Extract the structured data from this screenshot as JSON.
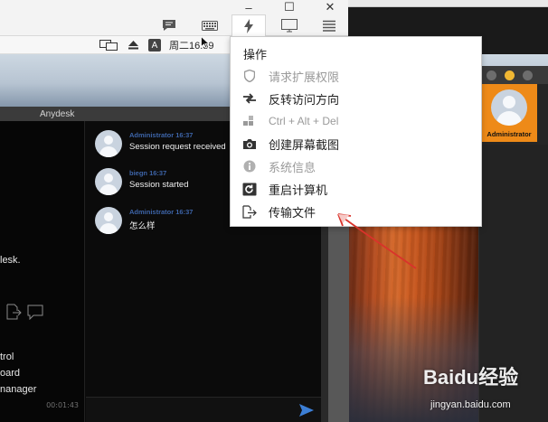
{
  "toolbar": {
    "controls": [
      "–",
      "☐",
      "✕"
    ],
    "tools": [
      "chat-icon",
      "keyboard-icon",
      "actions-icon",
      "display-icon",
      "menu-icon"
    ]
  },
  "menubar": {
    "ime_badge": "A",
    "clock": "周二16:39"
  },
  "anydesk": {
    "title": "Anydesk",
    "left_texts": [
      "lesk.",
      "trol",
      "oard",
      "nanager"
    ],
    "elapsed": "00:01:43",
    "messages": [
      {
        "name": "Administrator 16:37",
        "text": "Session request received"
      },
      {
        "name": "biegn 16:37",
        "text": "Session started"
      },
      {
        "name": "Administrator 16:37",
        "text": "怎么样"
      }
    ]
  },
  "menu": {
    "header": "操作",
    "items": [
      {
        "label": "请求扩展权限",
        "icon": "shield-icon",
        "enabled": false
      },
      {
        "label": "反转访问方向",
        "icon": "switch-direction-icon",
        "enabled": true
      },
      {
        "label": "Ctrl + Alt + Del",
        "icon": "ctrl-alt-del-icon",
        "enabled": false
      },
      {
        "label": "创建屏幕截图",
        "icon": "camera-icon",
        "enabled": true
      },
      {
        "label": "系统信息",
        "icon": "info-icon",
        "enabled": false
      },
      {
        "label": "重启计算机",
        "icon": "restart-icon",
        "enabled": true
      },
      {
        "label": "传输文件",
        "icon": "file-transfer-icon",
        "enabled": true
      }
    ]
  },
  "remote_user": {
    "name": "Administrator"
  },
  "watermark": {
    "logo": "Baidu经验",
    "url": "jingyan.baidu.com"
  },
  "colors": {
    "accent_orange": "#ee8a18",
    "chat_name_blue": "#3d64a8",
    "annotation_red": "#d9332b",
    "send_blue": "#3c7fd6"
  }
}
